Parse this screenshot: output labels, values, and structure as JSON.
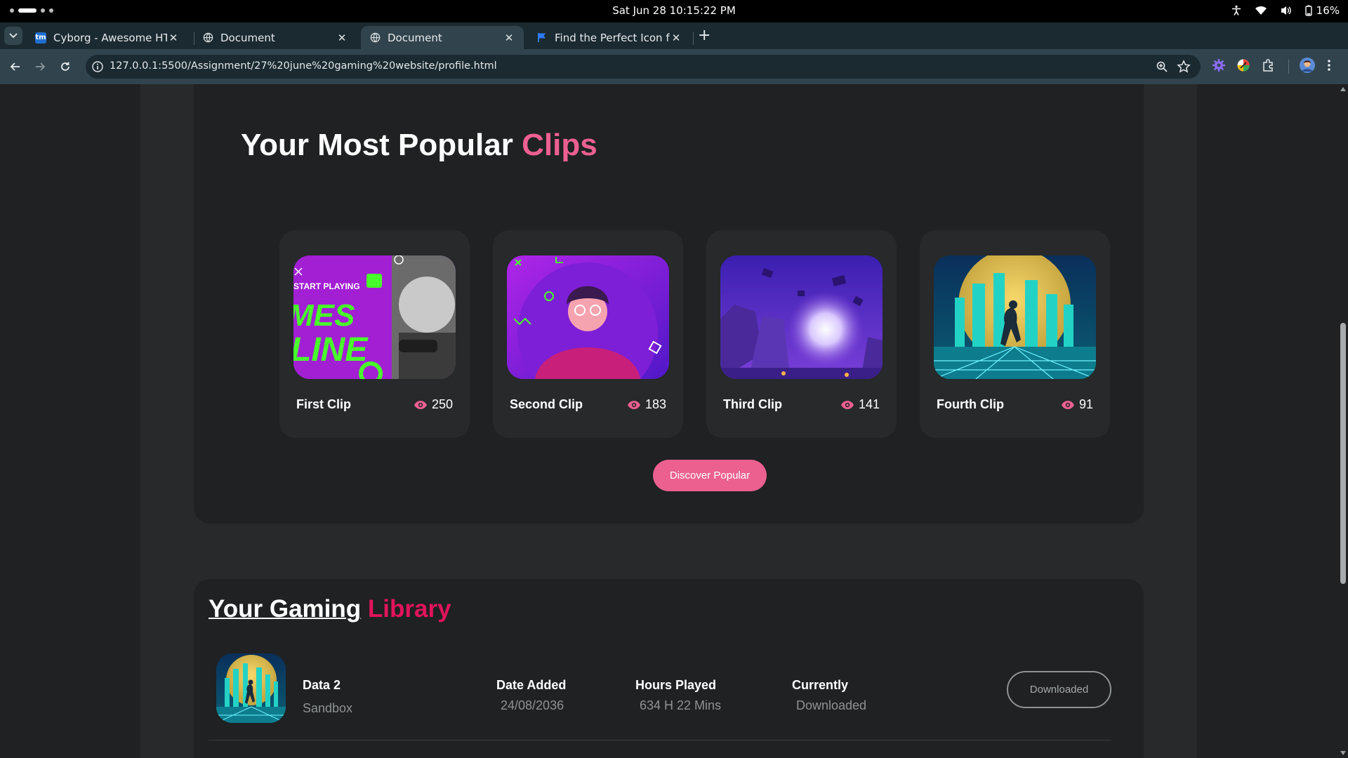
{
  "os": {
    "clock": "Sat Jun 28  10:15:22 PM",
    "battery": "16%",
    "icons": [
      "accessibility-icon",
      "wifi-icon",
      "volume-icon",
      "battery-icon"
    ]
  },
  "browser": {
    "tabs": [
      {
        "favicon": "tm",
        "title": "Cyborg - Awesome HTML"
      },
      {
        "favicon": "globe-icon",
        "title": "Document"
      },
      {
        "favicon": "globe-icon",
        "title": "Document",
        "active": true
      },
      {
        "favicon": "flag-icon",
        "title": "Find the Perfect Icon for"
      }
    ],
    "new_tab": "+",
    "url": "127.0.0.1:5500/Assignment/27%20june%20gaming%20website/profile.html"
  },
  "clips_section": {
    "heading_main": "Your Most Popular",
    "heading_accent": "Clips",
    "clips": [
      {
        "name": "First Clip",
        "views": "250",
        "thumbnail": "start-playing-games-online"
      },
      {
        "name": "Second Clip",
        "views": "183",
        "thumbnail": "cartoon-gamer"
      },
      {
        "name": "Third Clip",
        "views": "141",
        "thumbnail": "floating-rocks-planet"
      },
      {
        "name": "Fourth Clip",
        "views": "91",
        "thumbnail": "neon-city-skater"
      }
    ],
    "button": "Discover Popular"
  },
  "library_section": {
    "heading_main": "Your Gaming",
    "heading_accent": "Library",
    "items": [
      {
        "title": "Data 2",
        "genre": "Sandbox",
        "date_label": "Date Added",
        "date_value": "24/08/2036",
        "hours_label": "Hours Played",
        "hours_value": "634 H 22 Mins",
        "status_label": "Currently",
        "status_value": "Downloaded",
        "button": "Downloaded"
      }
    ]
  },
  "colors": {
    "accent_pink": "#ec6090",
    "accent_deep_pink": "#e1145c",
    "page_bg": "#1f2122",
    "card_bg": "#27292a"
  }
}
